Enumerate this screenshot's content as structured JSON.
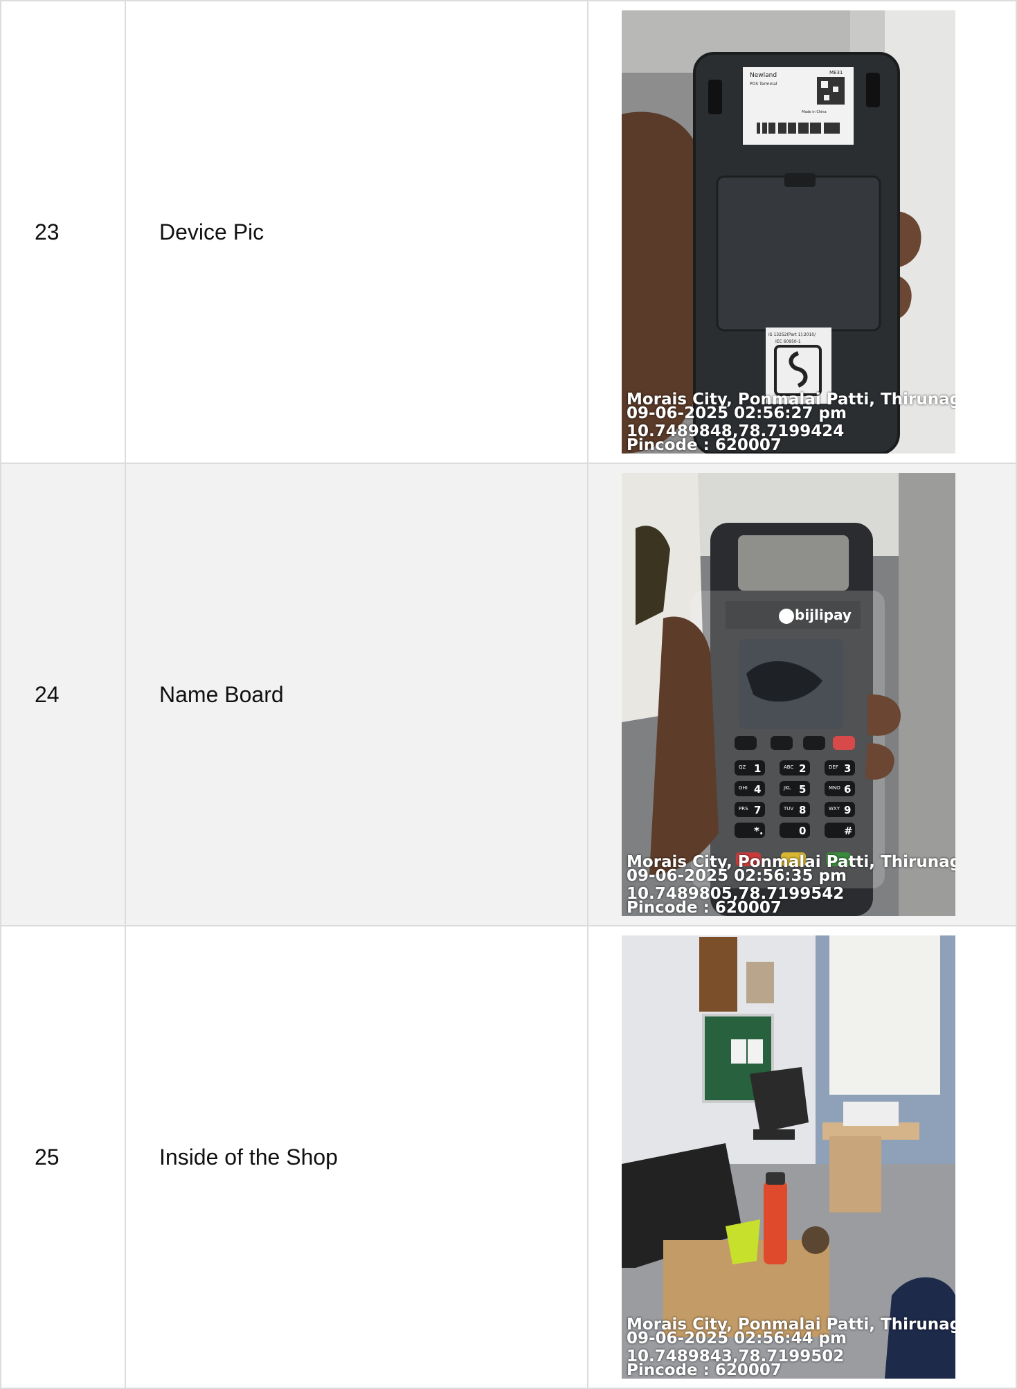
{
  "rows": [
    {
      "number": "23",
      "label": "Device Pic",
      "photo": {
        "subject": "pos-device-back",
        "stamp": {
          "address": "Morais City, Ponmalai Patti, Thirunagar, T",
          "datetime": "09-06-2025 02:56:27 pm",
          "coords": "10.7489848,78.7199424",
          "pincode": "Pincode : 620007"
        },
        "device_label": {
          "brand": "Newland",
          "model": "ME31",
          "line1": "POS Terminal",
          "made_in": "Made in China",
          "standard": "IS 13252(Part 1):2010/",
          "standard2": "IEC 60950-1"
        }
      }
    },
    {
      "number": "24",
      "label": "Name Board",
      "photo": {
        "subject": "pos-device-front",
        "stamp": {
          "address": "Morais City, Ponmalai Patti, Thirunagar, T",
          "datetime": "09-06-2025 02:56:35 pm",
          "coords": "10.7489805,78.7199542",
          "pincode": "Pincode : 620007"
        },
        "device_brand": "bijlipay",
        "keypad": [
          "1",
          "2",
          "3",
          "4",
          "5",
          "6",
          "7",
          "8",
          "9",
          "*.",
          "0",
          "#"
        ],
        "keypad_sub": [
          "QZ",
          "ABC",
          "DEF",
          "GHI",
          "JKL",
          "MNO",
          "PRS",
          "TUV",
          "WXY",
          "",
          "",
          ""
        ]
      }
    },
    {
      "number": "25",
      "label": "Inside of the Shop",
      "photo": {
        "subject": "shop-interior",
        "stamp": {
          "address": "Morais City, Ponmalai Patti, Thirunagar, T",
          "datetime": "09-06-2025 02:56:44 pm",
          "coords": "10.7489843,78.7199502",
          "pincode": "Pincode : 620007"
        }
      }
    }
  ],
  "colors": {
    "border": "#dcdcdc",
    "alt_row": "#f2f2f2",
    "text": "#111111"
  }
}
